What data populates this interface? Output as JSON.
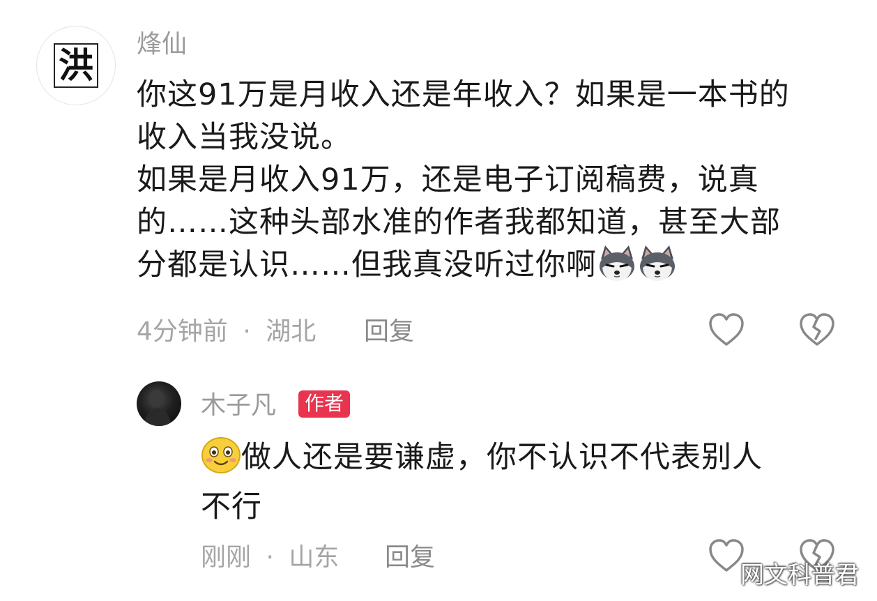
{
  "comment": {
    "username": "烽仙",
    "avatar_char": "洪",
    "text_lines": [
      "你这91万是月收入还是年收入？如果是一本书的",
      "收入当我没说。",
      "如果是月收入91万，还是电子订阅稿费，说真",
      "的……这种头部水准的作者我都知道，甚至大部",
      "分都是认识……但我真没听过你啊"
    ],
    "emoji_trailing": [
      "husky-emoji",
      "husky-emoji"
    ],
    "time": "4分钟前",
    "separator": "·",
    "location": "湖北",
    "reply_label": "回复"
  },
  "reply": {
    "username": "木子凡",
    "badge": "作者",
    "emoji_leading": "smile-emoji",
    "text_lines": [
      "做人还是要谦虚，你不认识不代表别人",
      "不行"
    ],
    "time": "刚刚",
    "separator": "·",
    "location": "山东",
    "reply_label": "回复"
  },
  "watermark": "网文科普君",
  "colors": {
    "badge": "#e8344e",
    "meta_text": "#a5a5a5",
    "icon_stroke": "#888888"
  }
}
